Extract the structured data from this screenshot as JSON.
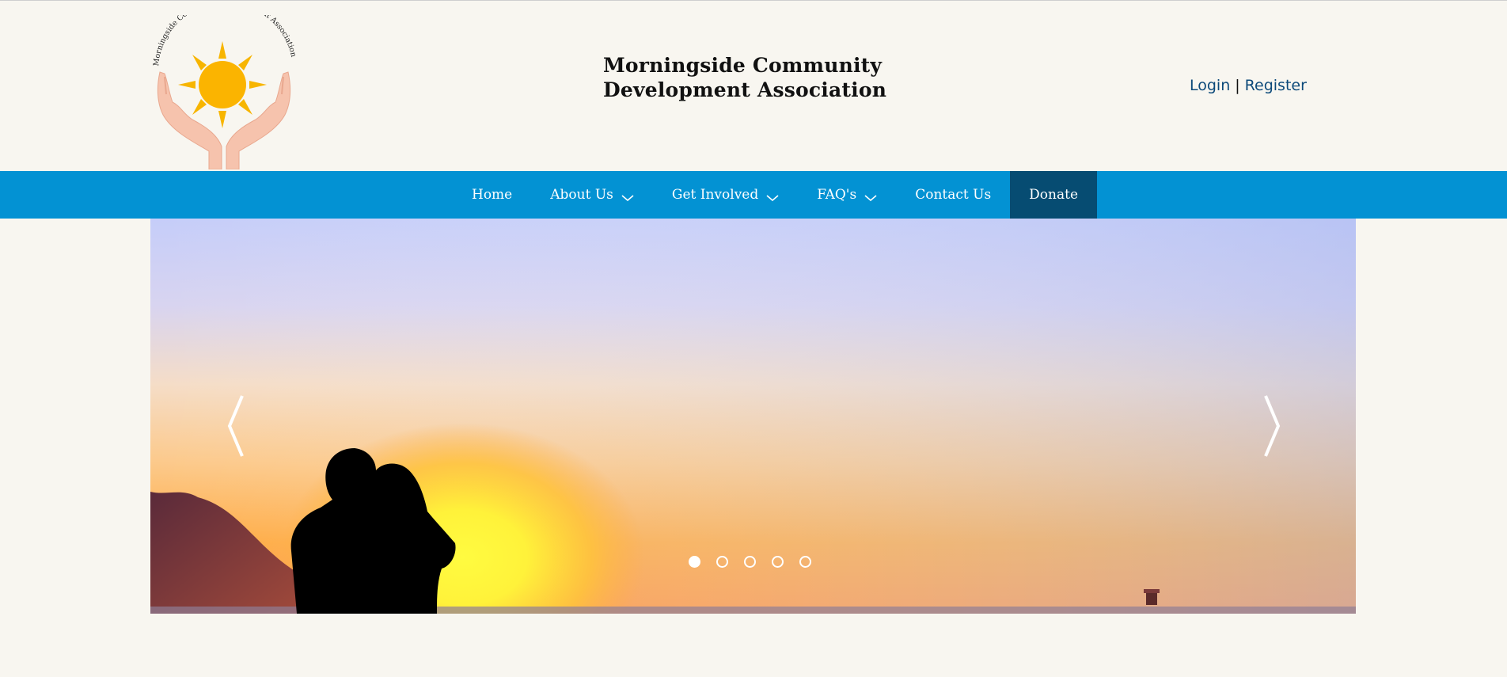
{
  "header": {
    "logo_text": "Morningside Community Development Association",
    "title_line1": "Morningside Community",
    "title_line2": "Development Association",
    "login_label": "Login",
    "separator": "|",
    "register_label": "Register"
  },
  "nav": {
    "items": [
      {
        "label": "Home",
        "has_dropdown": false
      },
      {
        "label": "About Us",
        "has_dropdown": true
      },
      {
        "label": "Get Involved",
        "has_dropdown": true
      },
      {
        "label": "FAQ's",
        "has_dropdown": true
      },
      {
        "label": "Contact Us",
        "has_dropdown": false
      },
      {
        "label": "Donate",
        "has_dropdown": false
      }
    ]
  },
  "slider": {
    "prev_icon": "chevron-left-icon",
    "next_icon": "chevron-right-icon",
    "slide_count": 5,
    "active_slide": 1
  },
  "colors": {
    "nav_bg": "#0392d3",
    "donate_bg": "#064c72",
    "page_bg": "#f8f6f0",
    "link": "#0d4a7a"
  }
}
